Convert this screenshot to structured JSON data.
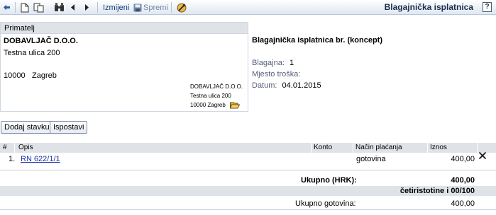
{
  "toolbar": {
    "edit_label": "Izmijeni",
    "save_label": "Spremi",
    "title": "Blagajnička isplatnica",
    "help_label": "?"
  },
  "recipient": {
    "header": "Primatelj",
    "name": "DOBAVLJAČ D.O.O.",
    "street": "Testna ulica 200",
    "zip": "10000",
    "city": "Zagreb",
    "box_lines": [
      "DOBAVLJAČ D.O.O.",
      "Testna ulica 200",
      "10000 Zagreb"
    ]
  },
  "document": {
    "title": "Blagajnička isplatnica br.  (koncept)",
    "register_label": "Blagajna:",
    "register_value": "1",
    "cost_center_label": "Mjesto troška:",
    "date_label": "Datum:",
    "date_value": "04.01.2015"
  },
  "buttons": {
    "add_item": "Dodaj stavku",
    "print": "Ispostavi"
  },
  "table": {
    "headers": {
      "num": "#",
      "description": "Opis",
      "account": "Konto",
      "payment": "Način plaćanja",
      "amount": "Iznos"
    },
    "rows": [
      {
        "num": "1.",
        "description": "RN 622/1/1",
        "account": "",
        "payment": "gotovina",
        "amount": "400,00"
      }
    ]
  },
  "totals": {
    "total_label": "Ukupno (HRK):",
    "total_value": "400,00",
    "in_words": "četiristotine i 00/100",
    "cash_label": "Ukupno gotovina:",
    "cash_value": "400,00"
  },
  "colors": {
    "link": "#1a2fa8",
    "header_bg": "#dfe3e8"
  }
}
